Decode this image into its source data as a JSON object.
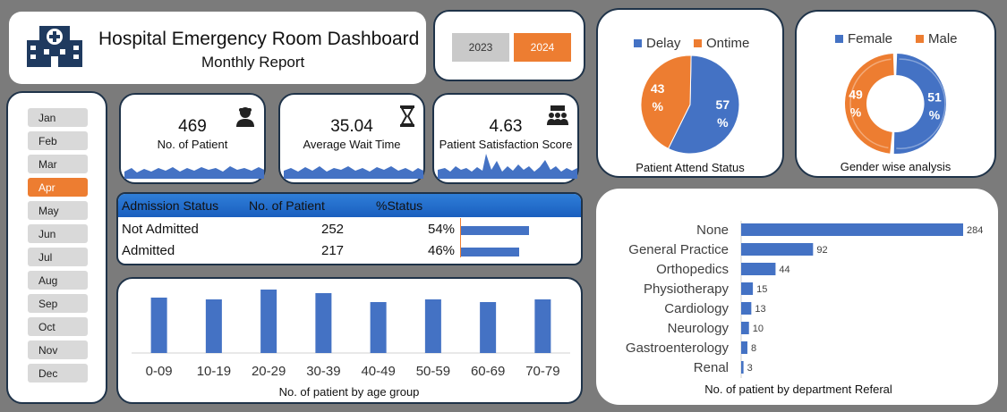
{
  "header": {
    "title": "Hospital Emergency Room Dashboard",
    "subtitle": "Monthly Report"
  },
  "years": [
    {
      "label": "2023",
      "active": false
    },
    {
      "label": "2024",
      "active": true
    }
  ],
  "months": [
    {
      "label": "Jan",
      "active": false
    },
    {
      "label": "Feb",
      "active": false
    },
    {
      "label": "Mar",
      "active": false
    },
    {
      "label": "Apr",
      "active": true
    },
    {
      "label": "May",
      "active": false
    },
    {
      "label": "Jun",
      "active": false
    },
    {
      "label": "Jul",
      "active": false
    },
    {
      "label": "Aug",
      "active": false
    },
    {
      "label": "Sep",
      "active": false
    },
    {
      "label": "Oct",
      "active": false
    },
    {
      "label": "Nov",
      "active": false
    },
    {
      "label": "Dec",
      "active": false
    }
  ],
  "kpis": {
    "patients": {
      "value": "469",
      "label": "No. of Patient",
      "icon": "patient-icon"
    },
    "wait": {
      "value": "35.04",
      "label": "Average Wait Time",
      "icon": "hourglass-icon"
    },
    "satisfaction": {
      "value": "4.63",
      "label": "Patient Satisfaction Score",
      "icon": "group-presentation-icon"
    }
  },
  "admission": {
    "headers": [
      "Admission Status",
      "No. of Patient",
      "%Status"
    ],
    "rows": [
      {
        "status": "Not Admitted",
        "count": "252",
        "pct": "54%",
        "share": 0.54
      },
      {
        "status": "Admitted",
        "count": "217",
        "pct": "46%",
        "share": 0.46
      }
    ]
  },
  "colors": {
    "blue": "#4472c4",
    "orange": "#ed7d31",
    "dark_border": "#1f3349"
  },
  "chart_data": [
    {
      "type": "pie",
      "title": "Patient Attend Status",
      "legend": "top",
      "series": [
        {
          "name": "Delay",
          "value": 57,
          "label": "57\n%"
        },
        {
          "name": "Ontime",
          "value": 43,
          "label": "43\n%"
        }
      ]
    },
    {
      "type": "pie",
      "variant": "donut",
      "title": "Gender wise analysis",
      "legend": "top",
      "series": [
        {
          "name": "Female",
          "value": 51,
          "label": "51\n%"
        },
        {
          "name": "Male",
          "value": 49,
          "label": "49\n%"
        }
      ]
    },
    {
      "type": "bar",
      "title": "No. of patient by age group",
      "categories": [
        "0-09",
        "10-19",
        "20-29",
        "30-39",
        "40-49",
        "50-59",
        "60-69",
        "70-79"
      ],
      "values": [
        62,
        60,
        71,
        67,
        57,
        60,
        57,
        60
      ],
      "ylim": [
        0,
        80
      ]
    },
    {
      "type": "bar",
      "orientation": "horizontal",
      "title": "No. of patient by department Referal",
      "categories": [
        "None",
        "General Practice",
        "Orthopedics",
        "Physiotherapy",
        "Cardiology",
        "Neurology",
        "Gastroenterology",
        "Renal"
      ],
      "values": [
        284,
        92,
        44,
        15,
        13,
        10,
        8,
        3
      ]
    }
  ]
}
